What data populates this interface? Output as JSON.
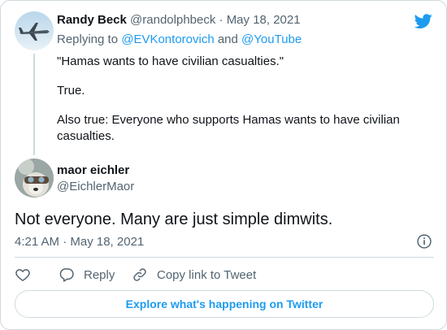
{
  "parent": {
    "name": "Randy Beck",
    "handle": "@randolphbeck",
    "separator": "·",
    "date": "May 18, 2021",
    "replying_prefix": "Replying to",
    "replying_user1": "@EVKontorovich",
    "replying_and": "and",
    "replying_user2": "@YouTube",
    "lines": [
      "\"Hamas wants to have civilian casualties.\"",
      "True.",
      "Also true: Everyone who supports Hamas wants to have civilian casualties."
    ]
  },
  "tweet": {
    "name": "maor eichler",
    "handle": "@EichlerMaor",
    "text": "Not everyone. Many are just simple dimwits.",
    "time": "4:21 AM · May 18, 2021"
  },
  "actions": {
    "like_icon": "heart-icon",
    "reply_label": "Reply",
    "copy_label": "Copy link to Tweet"
  },
  "cta": {
    "label": "Explore what's happening on Twitter"
  },
  "colors": {
    "accent": "#1d9bf0",
    "muted": "#536471",
    "border": "#cfd9de",
    "text": "#0f1419"
  }
}
